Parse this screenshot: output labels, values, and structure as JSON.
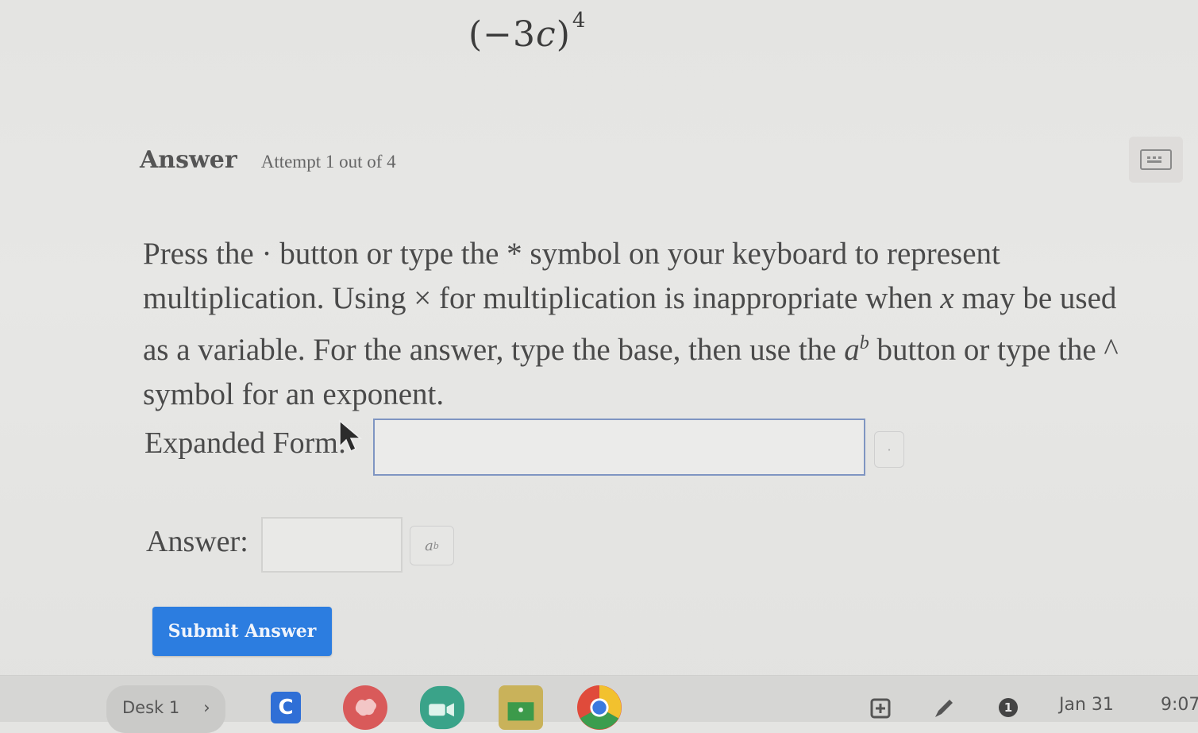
{
  "problem": {
    "base": "(−3",
    "variable": "c",
    "close": ")",
    "exponent": "4"
  },
  "answer_section": {
    "title": "Answer",
    "attempt": "Attempt 1 out of 4"
  },
  "instructions": {
    "part1": "Press the · button or type the * symbol on your keyboard to represent multiplication. Using × for multiplication is inappropriate when ",
    "var_x": "x",
    "part2": " may be used as a variable. For the answer, type the base, then use the ",
    "ab_a": "a",
    "ab_b": "b",
    "part3": " button or type the ^ symbol for an exponent."
  },
  "form": {
    "expanded_label": "Expanded Form:",
    "expanded_value": "",
    "mult_button_label": "·",
    "answer_label": "Answer:",
    "answer_value": "",
    "exp_button_base": "a",
    "exp_button_sup": "b",
    "submit_label": "Submit Answer"
  },
  "taskbar": {
    "desk_label": "Desk 1",
    "desk_chevron": "›",
    "classroom_letter": "C",
    "notification_count": "1",
    "date": "Jan 31",
    "time": "9:07"
  },
  "colors": {
    "submit_bg": "#2c7de0",
    "input_border_focus": "#7f95c2"
  }
}
